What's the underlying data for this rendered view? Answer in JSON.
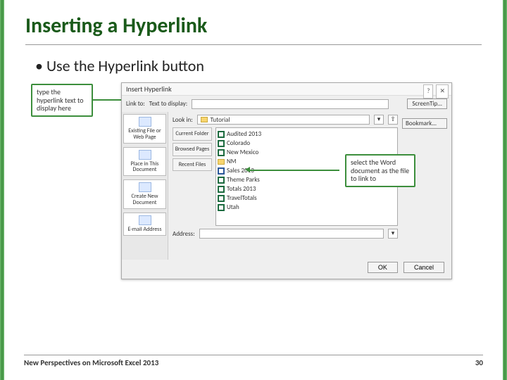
{
  "slide": {
    "title": "Inserting a Hyperlink",
    "bullet": "Use the Hyperlink button"
  },
  "callouts": {
    "left": "type the hyperlink text to display here",
    "right": "select the Word document as the file to link to"
  },
  "dialog": {
    "title": "Insert Hyperlink",
    "linkToLabel": "Link to:",
    "textToDisplayLabel": "Text to display:",
    "screenTip": "ScreenTip...",
    "lookInLabel": "Look in:",
    "lookInValue": "Tutorial",
    "bookmark": "Bookmark...",
    "linkToOptions": [
      {
        "label": "Existing File or Web Page"
      },
      {
        "label": "Place in This Document"
      },
      {
        "label": "Create New Document"
      },
      {
        "label": "E-mail Address"
      }
    ],
    "navTabs": [
      {
        "label": "Current Folder"
      },
      {
        "label": "Browsed Pages"
      },
      {
        "label": "Recent Files"
      }
    ],
    "files": [
      {
        "name": "Audited 2013",
        "type": "x"
      },
      {
        "name": "Colorado",
        "type": "x"
      },
      {
        "name": "New Mexico",
        "type": "x"
      },
      {
        "name": "NM",
        "type": "f"
      },
      {
        "name": "Sales 2013",
        "type": "w"
      },
      {
        "name": "Theme Parks",
        "type": "x"
      },
      {
        "name": "Totals 2013",
        "type": "x"
      },
      {
        "name": "TravelTotals",
        "type": "x"
      },
      {
        "name": "Utah",
        "type": "x"
      }
    ],
    "addressLabel": "Address:",
    "ok": "OK",
    "cancel": "Cancel"
  },
  "footer": {
    "left": "New Perspectives on Microsoft Excel 2013",
    "right": "30"
  }
}
